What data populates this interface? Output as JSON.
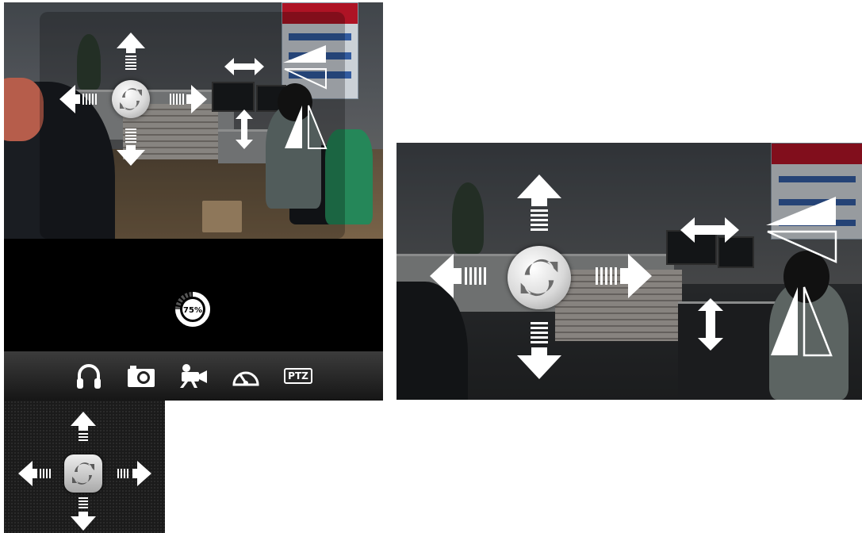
{
  "progress": {
    "value": 75,
    "label": "75%"
  },
  "toolbar": {
    "items": [
      {
        "name": "headphones-icon"
      },
      {
        "name": "camera-icon"
      },
      {
        "name": "video-camera-icon"
      },
      {
        "name": "speedometer-icon"
      },
      {
        "name": "ptz-button",
        "label": "PTZ"
      }
    ]
  },
  "colors": {
    "toolbar_top": "#3c3c3c",
    "toolbar_bottom": "#161616",
    "black_band": "#000000",
    "overlay_white": "#ffffff",
    "mini_panel": "#1b1b1b"
  }
}
